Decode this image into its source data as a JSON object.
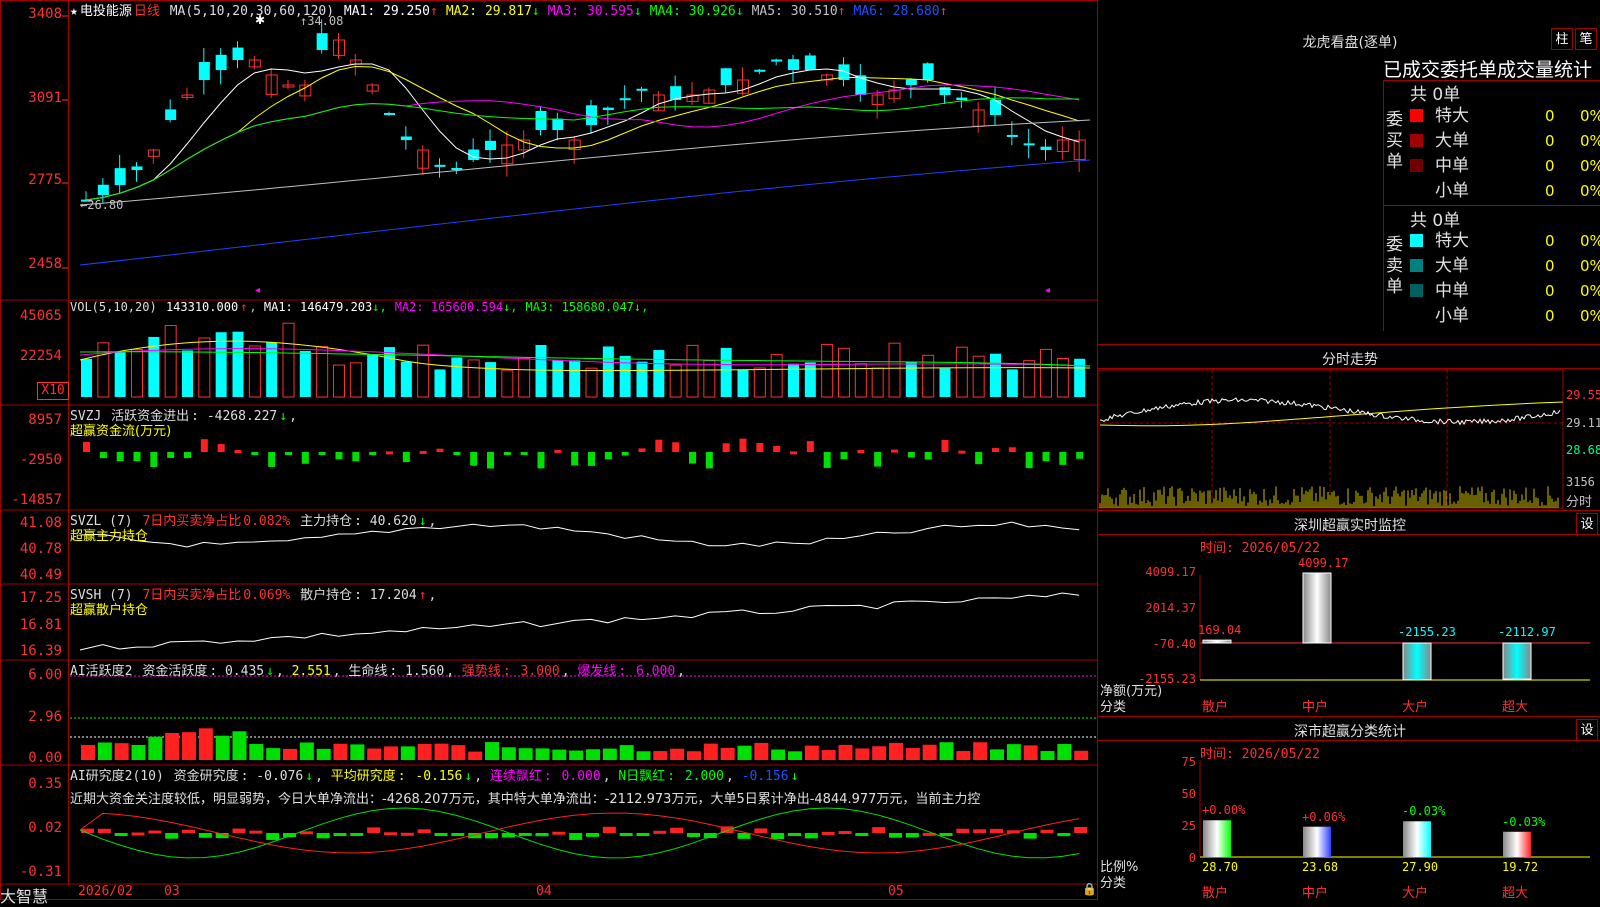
{
  "stock": {
    "name": "电投能源",
    "period": "日线",
    "ma_label": "MA(5,10,20,30,60,120)",
    "ma": [
      {
        "name": "MA1",
        "value": "29.250",
        "arrow": "↑",
        "color": "#ffffff"
      },
      {
        "name": "MA2",
        "value": "29.817",
        "arrow": "↓",
        "color": "#ffff00"
      },
      {
        "name": "MA3",
        "value": "30.595",
        "arrow": "↓",
        "color": "#ff00ff"
      },
      {
        "name": "MA4",
        "value": "30.926",
        "arrow": "↓",
        "color": "#00ff00"
      },
      {
        "name": "MA5",
        "value": "30.510",
        "arrow": "↑",
        "color": "#c0c0c0"
      },
      {
        "name": "MA6",
        "value": "28.680",
        "arrow": "↑",
        "color": "#2050ff"
      }
    ],
    "high_marker": "34.08",
    "low_marker": "26.80"
  },
  "price_axis": [
    "3408",
    "3091",
    "2775",
    "2458"
  ],
  "vol": {
    "label": "VOL(5,10,20)",
    "value": "143310.000",
    "items": [
      {
        "name": "MA1",
        "value": "146479.203",
        "arrow": "↓",
        "color": "#ffffff"
      },
      {
        "name": "MA2",
        "value": "165600.594",
        "arrow": "↓",
        "color": "#ff00ff"
      },
      {
        "name": "MA3",
        "value": "158680.047",
        "arrow": "↓",
        "color": "#00ff00"
      }
    ],
    "axis": [
      "45065",
      "22254"
    ],
    "unit": "X10"
  },
  "svzj": {
    "name": "SVZJ",
    "label": "活跃资金进出",
    "value": "-4268.227",
    "arrow": "↓",
    "sub": "超赢资金流(万元)",
    "axis": [
      "8957",
      "-2950",
      "-14857"
    ]
  },
  "svzl": {
    "name": "SVZL (7)",
    "ratio_label": "7日内买卖净占比",
    "ratio": "0.082%",
    "hold_label": "主力持仓",
    "hold": "40.620",
    "arrow": "↓",
    "sub": "超赢主力持仓",
    "axis": [
      "41.08",
      "40.78",
      "40.49"
    ]
  },
  "svsh": {
    "name": "SVSH (7)",
    "ratio_label": "7日内买卖净占比",
    "ratio": "0.069%",
    "hold_label": "散户持仓",
    "hold": "17.204",
    "arrow": "↑",
    "sub": "超赢散户持仓",
    "axis": [
      "17.25",
      "16.81",
      "16.39"
    ]
  },
  "ai_active": {
    "name": "AI活跃度2",
    "f1_label": "资金活跃度",
    "f1": "0.435",
    "f1_arrow": "↓",
    "f2": "2.551",
    "life_label": "生命线",
    "life": "1.560",
    "strong_label": "强势线",
    "strong": "3.000",
    "burst_label": "爆发线",
    "burst": "6.000",
    "axis": [
      "6.00",
      "2.96",
      "0.00"
    ]
  },
  "ai_research": {
    "name": "AI研究度2(10)",
    "f1_label": "资金研究度",
    "f1": "-0.076",
    "f1_arrow": "↓",
    "f2_label": "平均研究度",
    "f2": "-0.156",
    "f2_arrow": "↓",
    "f3_label": "连续飘红",
    "f3": "0.000",
    "f4_label": "N日飘红",
    "f4": "2.000",
    "f5": "-0.156",
    "f5_arrow": "↓",
    "comment": "近期大资金关注度较低，明显弱势，今日大单净流出：-4268.207万元，其中特大单净流出：-2112.973万元，大单5日累计净出-4844.977万元，当前主力控",
    "axis": [
      "0.35",
      "0.02",
      "-0.31"
    ]
  },
  "bottom": {
    "brand": "大智慧",
    "dates": [
      "2026/02",
      "03",
      "04",
      "05"
    ]
  },
  "right": {
    "lhb_title": "龙虎看盘(逐单)",
    "btn_column": "柱",
    "btn_pen": "笔",
    "order_title": "已成交委托单成交量统计",
    "buy_label": "委买单",
    "sell_label": "委卖单",
    "buy_total": "共 0单",
    "sell_total": "共 0单",
    "buy_rows": [
      {
        "label": "特大",
        "value": "0",
        "pct": "0%",
        "color": "#ff0000"
      },
      {
        "label": "大单",
        "value": "0",
        "pct": "0%",
        "color": "#a00000"
      },
      {
        "label": "中单",
        "value": "0",
        "pct": "0%",
        "color": "#700000"
      },
      {
        "label": "小单",
        "value": "0",
        "pct": "0%",
        "color": "#000000"
      }
    ],
    "sell_rows": [
      {
        "label": "特大",
        "value": "0",
        "pct": "0%",
        "color": "#00ffff"
      },
      {
        "label": "大单",
        "value": "0",
        "pct": "0%",
        "color": "#008080"
      },
      {
        "label": "中单",
        "value": "0",
        "pct": "0%",
        "color": "#006060"
      },
      {
        "label": "小单",
        "value": "0",
        "pct": "0%",
        "color": "#000000"
      }
    ],
    "intraday_title": "分时走势",
    "intraday_axis": [
      "29.55",
      "29.11",
      "28.68"
    ],
    "intraday_vol": "3156",
    "intraday_unit": "分时",
    "sz_title": "深圳超赢实时监控",
    "sz_btn": "设",
    "sz_time": "时间: 2026/05/22",
    "sz_axis": [
      "4099.17",
      "2014.37",
      "-70.40",
      "-2155.23"
    ],
    "sz_unit": "净额(万元)",
    "sz_class": "分类",
    "sz_bars": [
      {
        "label": "散户",
        "value": "169.04"
      },
      {
        "label": "中户",
        "value": "4099.17"
      },
      {
        "label": "大户",
        "value": "-2155.23"
      },
      {
        "label": "超大",
        "value": "-2112.97"
      }
    ],
    "cls_title": "深市超赢分类统计",
    "cls_btn": "设",
    "cls_time": "时间: 2026/05/22",
    "cls_axis": [
      "75",
      "50",
      "25",
      "0"
    ],
    "cls_unit": "比例%",
    "cls_class": "分类",
    "cls_bars": [
      {
        "label": "散户",
        "value": "28.70",
        "delta": "+0.00%",
        "color": "#00ff00"
      },
      {
        "label": "中户",
        "value": "23.68",
        "delta": "+0.06%",
        "color": "#3040ff"
      },
      {
        "label": "大户",
        "value": "27.90",
        "delta": "-0.03%",
        "color": "#00ffff"
      },
      {
        "label": "超大",
        "value": "19.72",
        "delta": "-0.03%",
        "color": "#ff2020"
      }
    ]
  }
}
